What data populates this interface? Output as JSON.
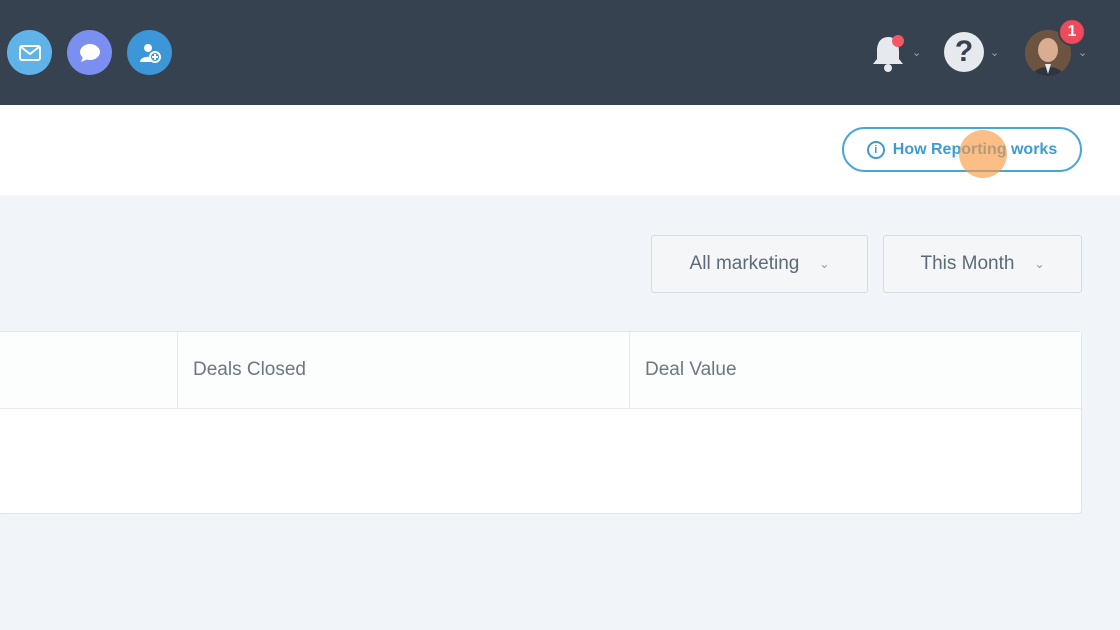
{
  "header": {
    "notifications_badge": "1",
    "help_symbol": "?"
  },
  "subheader": {
    "how_reporting_label": "How Reporting works",
    "info_symbol": "i"
  },
  "filters": {
    "marketing_selected": "All marketing",
    "period_selected": "This Month"
  },
  "table": {
    "columns": [
      "Deals Closed",
      "Deal Value"
    ]
  },
  "colors": {
    "topbar": "#36424f",
    "accent": "#3d9bd2",
    "badge": "#f04a5a"
  }
}
